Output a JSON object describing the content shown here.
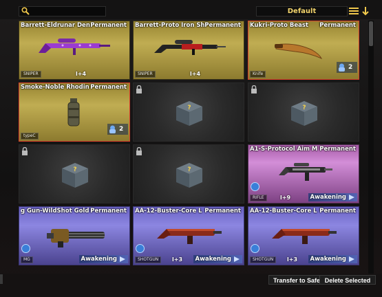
{
  "search": {
    "value": "",
    "placeholder": ""
  },
  "sort": {
    "selected": "Default"
  },
  "colors": {
    "gold_card": "#b5a24a",
    "purple_card": "#c47ac8",
    "blue_card": "#7c75d8",
    "selected_border": "#d9402a",
    "sort_text": "#f2d46c"
  },
  "items": [
    {
      "name": "Barrett-Eldrunar Den",
      "status": "Permanent",
      "type": "SNIPER",
      "level": "l+4",
      "icon": "purple-sniper-rifle"
    },
    {
      "name": "Barrett-Proto Iron Sh",
      "status": "Permanent",
      "type": "SNIPER",
      "level": "l+4",
      "icon": "red-sniper-rifle"
    },
    {
      "name": "Kukri-Proto Beast",
      "status": "Permanent",
      "type": "Knife",
      "count": "2",
      "icon": "kukri-knife"
    },
    {
      "name": "Smoke-Noble Rhodin",
      "status": "Permanent",
      "type": "typeC",
      "count": "2",
      "icon": "smoke-grenade"
    },
    {
      "icon": "mystery-box"
    },
    {
      "icon": "mystery-box"
    },
    {
      "icon": "mystery-box"
    },
    {
      "icon": "mystery-box"
    },
    {
      "name": "A1-S-Protocol Aim M",
      "status": "Permanent",
      "type": "RIFLE",
      "level": "l+9",
      "awaken": "Awakening",
      "icon": "assault-rifle"
    },
    {
      "name": "g Gun-WildShot Gold",
      "status": "Permanent",
      "type": "MG",
      "awaken": "Awakening",
      "icon": "gatling-gun"
    },
    {
      "name": "AA-12-Buster-Core L",
      "status": "Permanent",
      "type": "SHOTGUN",
      "level": "l+3",
      "awaken": "Awakening",
      "icon": "shotgun"
    },
    {
      "name": "AA-12-Buster-Core L",
      "status": "Permanent",
      "type": "SHOTGUN",
      "level": "l+3",
      "awaken": "Awakening",
      "icon": "shotgun"
    }
  ],
  "buttons": {
    "transfer": "Transfer to Safe",
    "delete": "Delete Selected"
  }
}
